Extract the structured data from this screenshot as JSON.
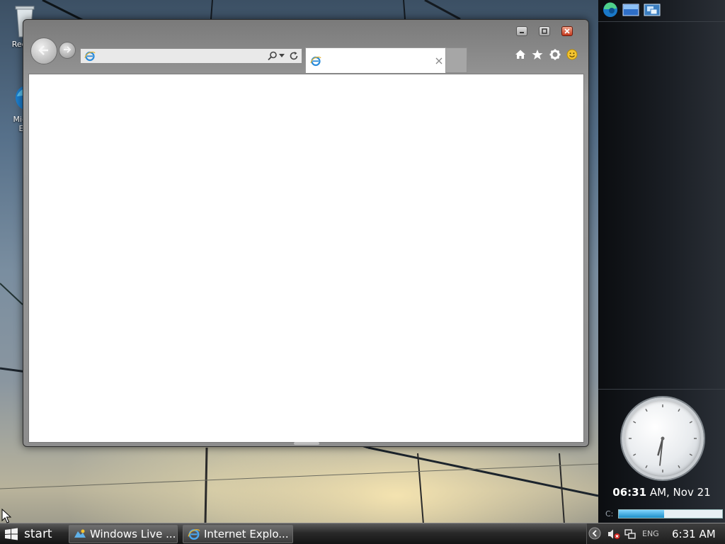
{
  "desktop": {
    "icons": [
      {
        "label": "Recy",
        "icon": "recycle-bin-icon"
      },
      {
        "label": "Micr\nE",
        "icon": "edge-icon"
      }
    ]
  },
  "browser": {
    "address": {
      "value": "",
      "placeholder": ""
    },
    "tab": {
      "title": ""
    },
    "window_buttons": [
      "minimize",
      "maximize",
      "close"
    ],
    "tools": [
      "home-icon",
      "favorites-icon",
      "settings-icon",
      "feedback-icon"
    ]
  },
  "sidebar": {
    "buttons": [
      "edge-icon",
      "show-desktop-icon",
      "switch-windows-icon"
    ],
    "clock": {
      "hour": 6,
      "minute": 31
    },
    "clock_text": {
      "time": "06:31",
      "rest": " AM, Nov 21"
    },
    "drive": {
      "label": "C:",
      "used_fraction": 0.44
    }
  },
  "taskbar": {
    "start_label": "start",
    "buttons": [
      {
        "label": "Windows Live ...",
        "icon": "windows-live-icon"
      },
      {
        "label": "Internet Explo...",
        "icon": "internet-explorer-icon"
      }
    ],
    "tray": {
      "lang": "ENG",
      "time": "6:31 AM"
    }
  },
  "colors": {
    "accent": "#1e8fc8",
    "close": "#c4391d"
  }
}
